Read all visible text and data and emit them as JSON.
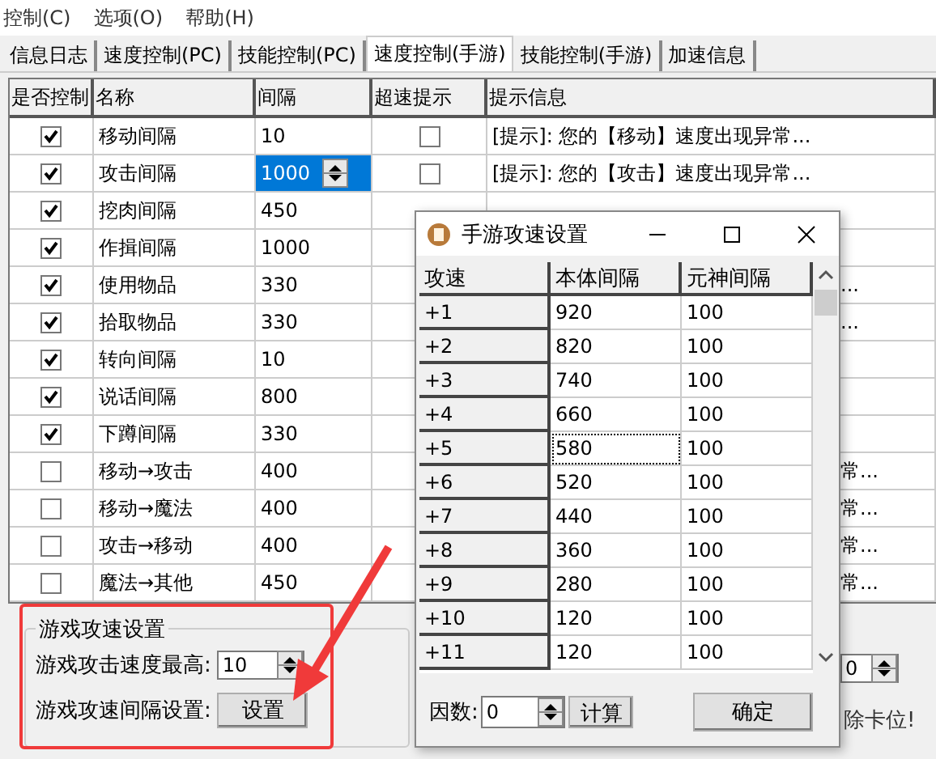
{
  "menu": [
    {
      "label": "控制(C)"
    },
    {
      "label": "选项(O)"
    },
    {
      "label": "帮助(H)"
    }
  ],
  "tabs": [
    {
      "label": "信息日志",
      "selected": false
    },
    {
      "label": "速度控制(PC)",
      "selected": false
    },
    {
      "label": "技能控制(PC)",
      "selected": false
    },
    {
      "label": "速度控制(手游)",
      "selected": true
    },
    {
      "label": "技能控制(手游)",
      "selected": false
    },
    {
      "label": "加速信息",
      "selected": false
    }
  ],
  "table": {
    "columns": [
      "是否控制",
      "名称",
      "间隔",
      "超速提示",
      "提示信息"
    ],
    "rows": [
      {
        "controlled": true,
        "name": "移动间隔",
        "interval": "10",
        "editing": false,
        "over_speed": false,
        "hint": "[提示]: 您的【移动】速度出现异常...",
        "kind": "full"
      },
      {
        "controlled": true,
        "name": "攻击间隔",
        "interval": "1000",
        "editing": true,
        "over_speed": false,
        "hint": "[提示]: 您的【攻击】速度出现异常...",
        "kind": "full"
      },
      {
        "controlled": true,
        "name": "挖肉间隔",
        "interval": "450",
        "editing": false
      },
      {
        "controlled": true,
        "name": "作揖间隔",
        "interval": "1000",
        "editing": false
      },
      {
        "controlled": true,
        "name": "使用物品",
        "interval": "330",
        "editing": false,
        "hint": "...",
        "kind": "tail"
      },
      {
        "controlled": true,
        "name": "拾取物品",
        "interval": "330",
        "editing": false,
        "hint": "...",
        "kind": "tail"
      },
      {
        "controlled": true,
        "name": "转向间隔",
        "interval": "10",
        "editing": false
      },
      {
        "controlled": true,
        "name": "说话间隔",
        "interval": "800",
        "editing": false
      },
      {
        "controlled": true,
        "name": "下蹲间隔",
        "interval": "330",
        "editing": false
      },
      {
        "controlled": false,
        "name": "移动→攻击",
        "interval": "400",
        "editing": false,
        "hint": "常...",
        "kind": "tail"
      },
      {
        "controlled": false,
        "name": "移动→魔法",
        "interval": "400",
        "editing": false,
        "hint": "常...",
        "kind": "tail"
      },
      {
        "controlled": false,
        "name": "攻击→移动",
        "interval": "400",
        "editing": false,
        "hint": "常...",
        "kind": "tail"
      },
      {
        "controlled": false,
        "name": "魔法→其他",
        "interval": "450",
        "editing": false,
        "hint": "常...",
        "kind": "tail"
      }
    ]
  },
  "speed_group": {
    "title": "游戏攻速设置",
    "max_label": "游戏攻击速度最高:",
    "max_value": "10",
    "interval_label": "游戏攻速间隔设置:",
    "button": "设置"
  },
  "right_fragment": {
    "value": "0",
    "text": "除卡位!"
  },
  "dialog": {
    "title": "手游攻速设置",
    "columns": [
      "攻速",
      "本体间隔",
      "元神间隔"
    ],
    "rows": [
      {
        "speed": "+1",
        "body": "920",
        "spirit": "100",
        "focused": false
      },
      {
        "speed": "+2",
        "body": "820",
        "spirit": "100",
        "focused": false
      },
      {
        "speed": "+3",
        "body": "740",
        "spirit": "100",
        "focused": false
      },
      {
        "speed": "+4",
        "body": "660",
        "spirit": "100",
        "focused": false
      },
      {
        "speed": "+5",
        "body": "580",
        "spirit": "100",
        "focused": true
      },
      {
        "speed": "+6",
        "body": "520",
        "spirit": "100",
        "focused": false
      },
      {
        "speed": "+7",
        "body": "440",
        "spirit": "100",
        "focused": false
      },
      {
        "speed": "+8",
        "body": "360",
        "spirit": "100",
        "focused": false
      },
      {
        "speed": "+9",
        "body": "280",
        "spirit": "100",
        "focused": false
      },
      {
        "speed": "+10",
        "body": "120",
        "spirit": "100",
        "focused": false
      },
      {
        "speed": "+11",
        "body": "120",
        "spirit": "100",
        "focused": false
      }
    ],
    "factor_label": "因数:",
    "factor_value": "0",
    "calc_button": "计算",
    "ok_button": "确定"
  }
}
